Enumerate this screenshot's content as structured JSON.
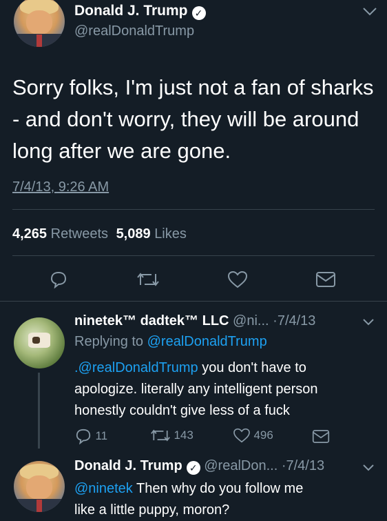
{
  "main_tweet": {
    "author_name": "Donald J. Trump",
    "author_handle": "@realDonaldTrump",
    "text_lines": [
      "Sorry folks, I'm just not a fan of sharks",
      "- and don't worry, they will be around",
      "long after we are gone."
    ],
    "timestamp": "7/4/13, 9:26 AM",
    "retweets_count": "4,265",
    "retweets_label": "Retweets",
    "likes_count": "5,089",
    "likes_label": "Likes",
    "actions": [
      "reply-icon",
      "retweet-icon",
      "like-icon",
      "message-icon"
    ]
  },
  "reply_1": {
    "author_name": "ninetek™ dadtek™ LLC",
    "author_handle": "@ni...",
    "time": "·7/4/13",
    "replying_to_label": "Replying to",
    "replying_to_handle": "@realDonaldTrump",
    "text_mention": ".@realDonaldTrump",
    "text_line1_rest": " you don't have to",
    "text_line2": "apologize. literally any intelligent person",
    "text_line3": "honestly couldn't give less of a fuck",
    "reply_count": "11",
    "retweet_count": "143",
    "like_count": "496"
  },
  "reply_2": {
    "author_name": "Donald J. Trump",
    "author_handle": "@realDon...",
    "time": "·7/4/13",
    "text_mention": "@ninetek",
    "text_line1_rest": "Then why do you follow me",
    "text_line2": "like a little puppy, moron?"
  },
  "colors": {
    "background": "#141d26",
    "muted": "#8899a6",
    "link": "#1da1f2",
    "divider": "#38444d"
  }
}
